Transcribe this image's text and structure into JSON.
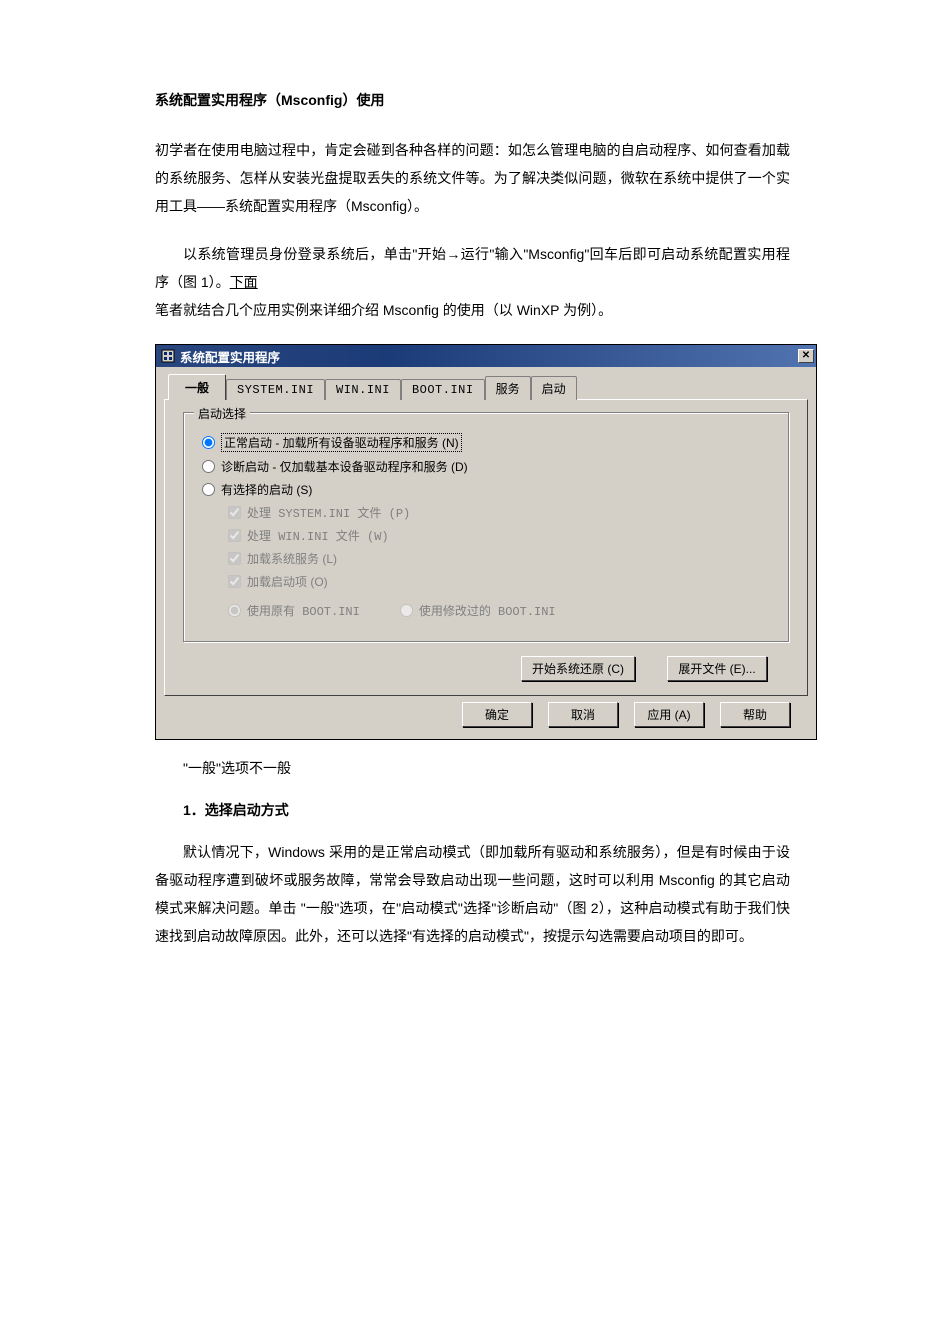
{
  "article": {
    "title": "系统配置实用程序（Msconfig）使用",
    "para1": "初学者在使用电脑过程中，肯定会碰到各种各样的问题：如怎么管理电脑的自启动程序、如何查看加载的系统服务、怎样从安装光盘提取丢失的系统文件等。为了解决类似问题，微软在系统中提供了一个实用工具——系统配置实用程序（Msconfig）。",
    "para2_prefix": "以系统管理员身份登录系统后，单击\"开始→运行\"输入\"Msconfig\"回车后即可启动系统配置实用程序（图 1）。",
    "para2_underline": "下面",
    "para2_suffix": "笔者就结合几个应用实例来详细介绍 Msconfig 的使用（以 WinXP 为例）。",
    "quoted_line": "\"一般\"选项不一般",
    "heading1": "1．选择启动方式",
    "para3": "默认情况下，Windows 采用的是正常启动模式（即加载所有驱动和系统服务），但是有时候由于设备驱动程序遭到破坏或服务故障，常常会导致启动出现一些问题，这时可以利用 Msconfig 的其它启动模式来解决问题。单击 \"一般\"选项，在\"启动模式\"选择\"诊断启动\"（图 2），这种启动模式有助于我们快速找到启动故障原因。此外，还可以选择\"有选择的启动模式\"，按提示勾选需要启动项目的即可。"
  },
  "dialog": {
    "title": "系统配置实用程序",
    "tabs": [
      "一般",
      "SYSTEM.INI",
      "WIN.INI",
      "BOOT.INI",
      "服务",
      "启动"
    ],
    "active_tab_index": 0,
    "group": {
      "legend": "启动选择",
      "radio_normal": "正常启动 - 加载所有设备驱动程序和服务 (N)",
      "radio_diag": "诊断启动 - 仅加载基本设备驱动程序和服务 (D)",
      "radio_select": "有选择的启动 (S)",
      "chk_system": "处理 SYSTEM.INI 文件 (P)",
      "chk_win": "处理 WIN.INI 文件 (W)",
      "chk_services": "加载系统服务 (L)",
      "chk_startup": "加载启动项 (O)",
      "radio_orig_boot": "使用原有 BOOT.INI",
      "radio_mod_boot": "使用修改过的 BOOT.INI",
      "btn_restore": "开始系统还原 (C)",
      "btn_expand": "展开文件 (E)..."
    },
    "footer": {
      "ok": "确定",
      "cancel": "取消",
      "apply": "应用 (A)",
      "help": "帮助"
    }
  }
}
